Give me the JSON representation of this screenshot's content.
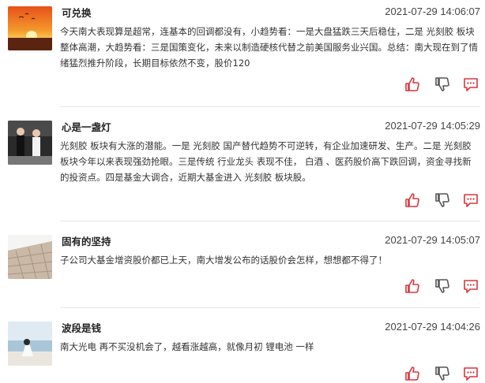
{
  "posts": [
    {
      "user": "可兑换",
      "time": "2021-07-29 14:06:07",
      "content": "今天南大表现算是超常，连基本的回调都没有，小趋势看：一是大盘猛跌三天后稳住，二是 光刻胶 板块整体高潮，大趋势看：三是国策变化，未来以制造硬核代替之前美国服务业兴国。总结：南大现在到了情绪猛烈推升阶段，长期目标依然不变，股价120",
      "avatar": "sunset-image"
    },
    {
      "user": "心是一盏灯",
      "time": "2021-07-29 14:05:29",
      "content": "光刻胶 板块有大涨的潜能。一是 光刻胶 国产替代趋势不可逆转，有企业加速研发、生产。二是 光刻胶 板块今年以来表现强劲抢眼。三是传统 行业龙头 表现不佳， 白酒 、医药股价高下跌回调，资金寻找新的投资点。四是基金大调合，近期大基金进入 光刻胶 板块股。",
      "avatar": "people-photo"
    },
    {
      "user": "固有的坚持",
      "time": "2021-07-29 14:05:07",
      "content": "子公司大基金增资股价都已上天，南大增发公布的话股价会怎样，想想都不得了！",
      "avatar": "pavement-photo"
    },
    {
      "user": "波段是钱",
      "time": "2021-07-29 14:04:26",
      "content": "南大光电 再不买没机会了，越看涨越高，就像月初 锂电池 一样",
      "avatar": "seaside-photo"
    }
  ],
  "icons": {
    "like": "thumbs-up-icon",
    "dislike": "thumbs-down-icon",
    "comment": "comment-icon"
  },
  "colors": {
    "icon_red": "#d9363e",
    "icon_gray": "#555555",
    "divider": "#e6e6e6"
  }
}
